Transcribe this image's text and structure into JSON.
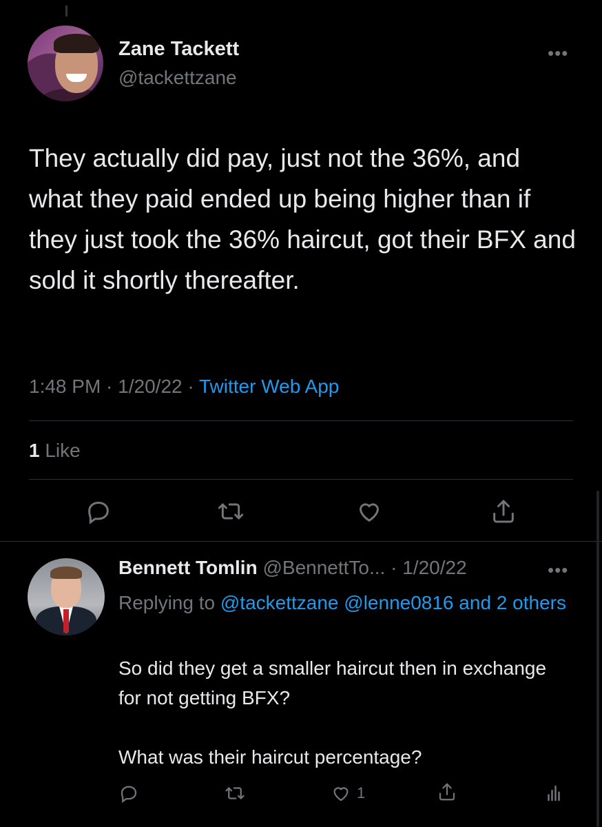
{
  "main_tweet": {
    "author_name": "Zane Tackett",
    "author_handle": "@tackettzane",
    "more_label": "•••",
    "text": "They actually did pay, just not the 36%, and what they paid ended up being higher than if they just took the 36% haircut, got their BFX and sold it shortly thereafter.",
    "time": "1:48 PM",
    "sep1": " · ",
    "date": "1/20/22",
    "sep2": " · ",
    "source": "Twitter Web App",
    "like_count": "1",
    "like_label": " Like",
    "icons": [
      "reply-icon",
      "retweet-icon",
      "like-icon",
      "share-icon"
    ]
  },
  "reply_tweet": {
    "author_name": "Bennett Tomlin",
    "author_handle": " @BennettTo...",
    "sep": " · ",
    "date": "1/20/22",
    "more_label": "•••",
    "replying_prefix": "Replying to ",
    "mention1": "@tackettzane",
    "mention2": " @lenne0816",
    "mention_rest": " and 2 others",
    "text_line1": "So did they get a smaller haircut then in exchange for not getting BFX?",
    "text_line2": "What was their haircut percentage?",
    "like_count": "1",
    "icons": [
      "reply-icon",
      "retweet-icon",
      "like-icon",
      "share-icon",
      "analytics-icon"
    ]
  },
  "colors": {
    "background": "#000000",
    "text_primary": "#e7e9ea",
    "text_secondary": "#71767b",
    "accent": "#1d9bf0",
    "divider": "#2f3336"
  }
}
